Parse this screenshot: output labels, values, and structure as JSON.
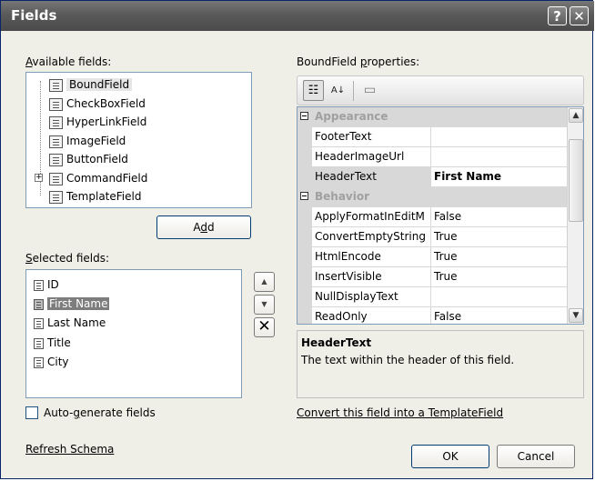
{
  "window": {
    "title": "Fields",
    "help_glyph": "?",
    "close_glyph": "✕"
  },
  "available": {
    "label_accel": "A",
    "label_rest": "vailable fields:",
    "items": [
      {
        "label": "BoundField",
        "icon": "boundfield-icon"
      },
      {
        "label": "CheckBoxField",
        "icon": "checkboxfield-icon"
      },
      {
        "label": "HyperLinkField",
        "icon": "hyperlinkfield-icon"
      },
      {
        "label": "ImageField",
        "icon": "imagefield-icon"
      },
      {
        "label": "ButtonField",
        "icon": "buttonfield-icon"
      },
      {
        "label": "CommandField",
        "icon": "commandfield-icon"
      },
      {
        "label": "TemplateField",
        "icon": "templatefield-icon"
      }
    ],
    "expand_glyph": "+",
    "add_pre": "A",
    "add_accel": "d",
    "add_post": "d"
  },
  "selected": {
    "label_accel": "S",
    "label_rest": "elected fields:",
    "items": [
      {
        "label": "ID"
      },
      {
        "label": "First Name"
      },
      {
        "label": "Last Name"
      },
      {
        "label": "Title"
      },
      {
        "label": "City"
      }
    ],
    "move_up_glyph": "▲",
    "move_down_glyph": "▼",
    "delete_glyph": "✕"
  },
  "props": {
    "label_pre": "BoundField ",
    "label_accel": "p",
    "label_post": "roperties:",
    "categorized_glyph": "☷",
    "alpha_glyph": "A↓",
    "pages_glyph": "▭",
    "rows": [
      {
        "kind": "cat",
        "name": "Appearance"
      },
      {
        "kind": "prop",
        "name": "FooterText",
        "value": ""
      },
      {
        "kind": "prop",
        "name": "HeaderImageUrl",
        "value": ""
      },
      {
        "kind": "prop",
        "name": "HeaderText",
        "value": "First Name",
        "selected": true
      },
      {
        "kind": "cat",
        "name": "Behavior"
      },
      {
        "kind": "prop",
        "name": "ApplyFormatInEditM",
        "value": "False"
      },
      {
        "kind": "prop",
        "name": "ConvertEmptyString",
        "value": "True"
      },
      {
        "kind": "prop",
        "name": "HtmlEncode",
        "value": "True"
      },
      {
        "kind": "prop",
        "name": "InsertVisible",
        "value": "True"
      },
      {
        "kind": "prop",
        "name": "NullDisplayText",
        "value": ""
      },
      {
        "kind": "prop",
        "name": "ReadOnly",
        "value": "False"
      }
    ],
    "scroll_up_glyph": "▲",
    "scroll_down_glyph": "▼"
  },
  "description": {
    "title": "HeaderText",
    "text": "The text within the header of this field."
  },
  "convert_link": "Convert this field into a TemplateField",
  "autogen": {
    "pre": "Auto-",
    "accel": "g",
    "post": "enerate fields",
    "checked": false
  },
  "refresh_link": "Refresh Schema",
  "ok_label": "OK",
  "cancel_label": "Cancel"
}
